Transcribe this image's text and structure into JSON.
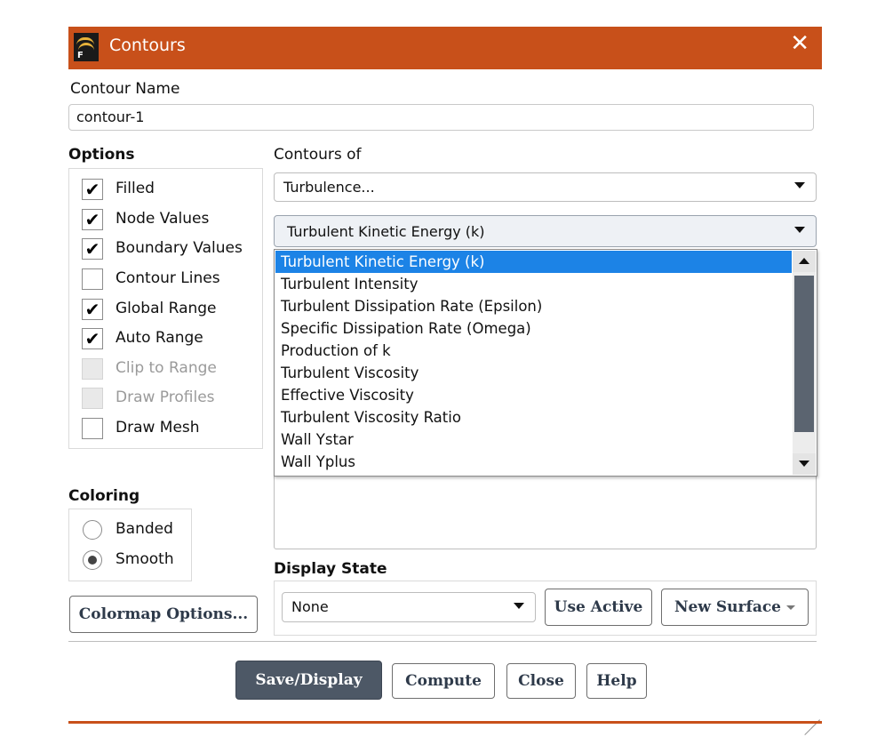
{
  "window": {
    "title": "Contours",
    "app_icon": "fluent-app-icon",
    "app_icon_letter": "F",
    "close_glyph": "✕",
    "title_color": "#c8501a"
  },
  "contour_name": {
    "label": "Contour Name",
    "value": "contour-1"
  },
  "options": {
    "label": "Options",
    "check_mark": "✔",
    "items": [
      {
        "label": "Filled",
        "checked": true,
        "enabled": true
      },
      {
        "label": "Node Values",
        "checked": true,
        "enabled": true
      },
      {
        "label": "Boundary Values",
        "checked": true,
        "enabled": true
      },
      {
        "label": "Contour Lines",
        "checked": false,
        "enabled": true
      },
      {
        "label": "Global Range",
        "checked": true,
        "enabled": true
      },
      {
        "label": "Auto Range",
        "checked": true,
        "enabled": true
      },
      {
        "label": "Clip to Range",
        "checked": false,
        "enabled": false
      },
      {
        "label": "Draw Profiles",
        "checked": false,
        "enabled": false
      },
      {
        "label": "Draw Mesh",
        "checked": false,
        "enabled": true
      }
    ]
  },
  "coloring": {
    "label": "Coloring",
    "items": [
      {
        "label": "Banded",
        "selected": false
      },
      {
        "label": "Smooth",
        "selected": true
      }
    ]
  },
  "contours_of": {
    "label": "Contours of",
    "category": "Turbulence...",
    "variable": "Turbulent Kinetic Energy (k)",
    "variable_options": [
      "Turbulent Kinetic Energy (k)",
      "Turbulent Intensity",
      "Turbulent Dissipation Rate (Epsilon)",
      "Specific Dissipation Rate (Omega)",
      "Production of k",
      "Turbulent Viscosity",
      "Effective Viscosity",
      "Turbulent Viscosity Ratio",
      "Wall Ystar",
      "Wall Yplus"
    ],
    "highlight_color": "#1c83e6"
  },
  "colormap_options_button": "Colormap Options...",
  "display_state": {
    "label": "Display State",
    "value": "None",
    "use_active_button": "Use Active",
    "new_surface_button": "New Surface"
  },
  "footer": {
    "save_display": "Save/Display",
    "compute": "Compute",
    "close": "Close",
    "help": "Help"
  }
}
